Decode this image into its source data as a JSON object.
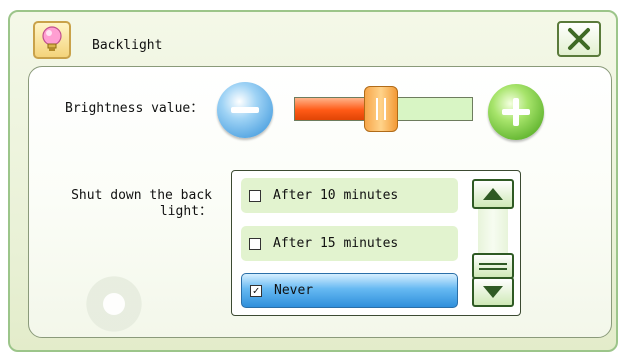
{
  "window": {
    "title": "Backlight",
    "title_icon": "lightbulb-icon",
    "close_icon": "close-x-icon"
  },
  "brightness": {
    "label": "Brightness value：",
    "minus_icon": "minus-icon",
    "plus_icon": "plus-icon",
    "level_fraction": 0.47
  },
  "shutdown": {
    "label": "Shut down the back light：",
    "options": [
      {
        "label": "After 10 minutes",
        "checked": false
      },
      {
        "label": "After 15 minutes",
        "checked": false
      },
      {
        "label": "Never",
        "checked": true
      }
    ],
    "scroll_up_icon": "arrow-up-icon",
    "scroll_down_icon": "arrow-down-icon",
    "scroll_handle_icon": "grip-icon"
  },
  "colors": {
    "accent_green": "#9cc58a",
    "slider_fill": "#ff5a16",
    "selected_option": "#4aa6ee"
  }
}
